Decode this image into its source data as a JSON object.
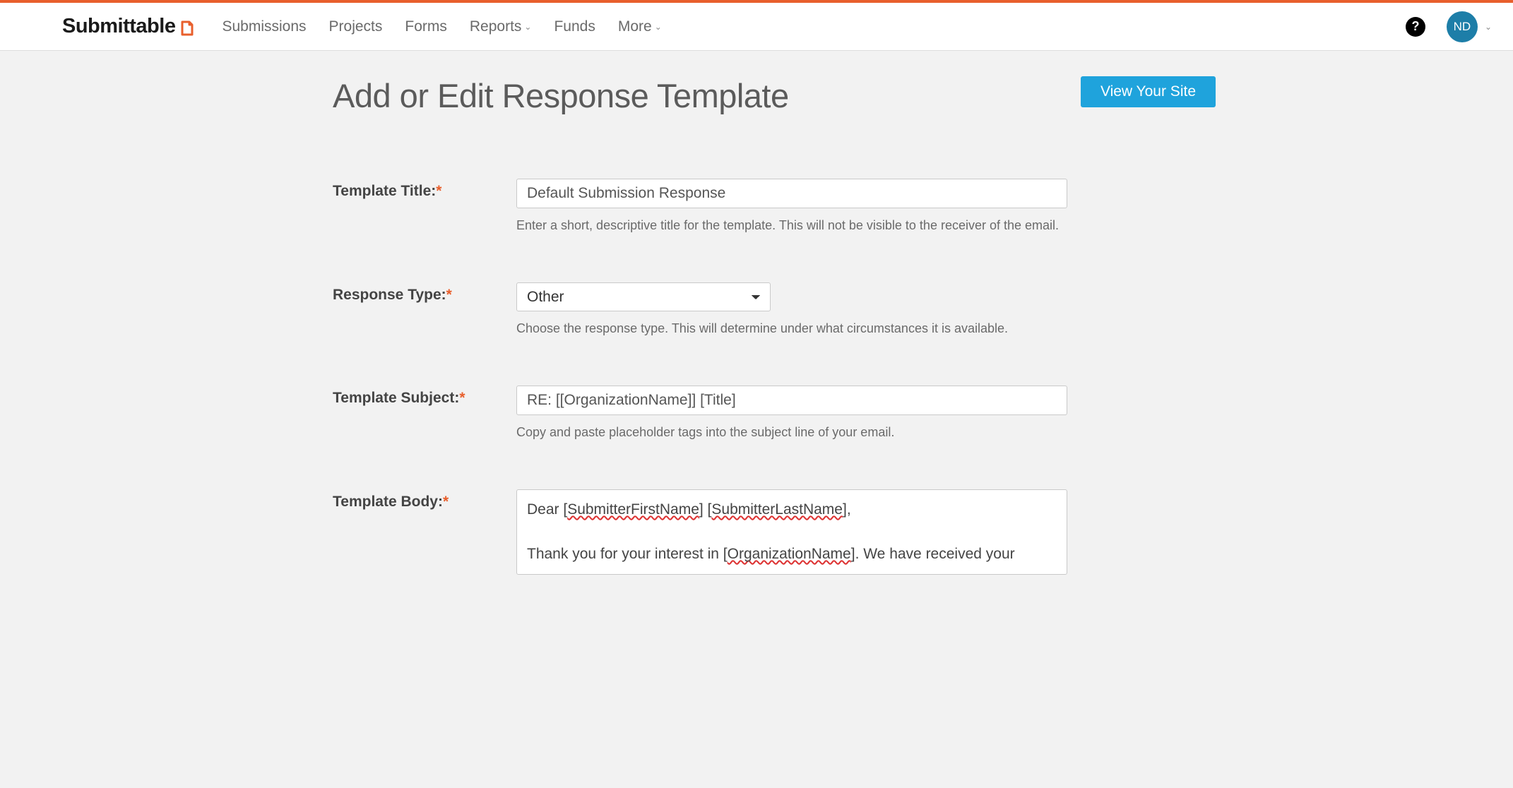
{
  "brand": "Submittable",
  "nav": {
    "submissions": "Submissions",
    "projects": "Projects",
    "forms": "Forms",
    "reports": "Reports",
    "funds": "Funds",
    "more": "More"
  },
  "user": {
    "initials": "ND"
  },
  "page": {
    "title": "Add or Edit Response Template",
    "view_site": "View Your Site"
  },
  "form": {
    "title_label": "Template Title:",
    "title_value": "Default Submission Response",
    "title_help": "Enter a short, descriptive title for the template. This will not be visible to the receiver of the email.",
    "type_label": "Response Type:",
    "type_value": "Other",
    "type_help": "Choose the response type. This will determine under what circumstances it is available.",
    "subject_label": "Template Subject:",
    "subject_value": "RE: [[OrganizationName]] [Title]",
    "subject_help": "Copy and paste placeholder tags into the subject line of your email.",
    "body_label": "Template Body:",
    "body_line1_prefix": "Dear [",
    "body_line1_tag1": "SubmitterFirstName",
    "body_line1_mid": "] [",
    "body_line1_tag2": "SubmitterLastName",
    "body_line1_suffix": "],",
    "body_line2_prefix": "Thank you for your interest in [",
    "body_line2_tag": "OrganizationName",
    "body_line2_suffix": "]. We have received your"
  }
}
